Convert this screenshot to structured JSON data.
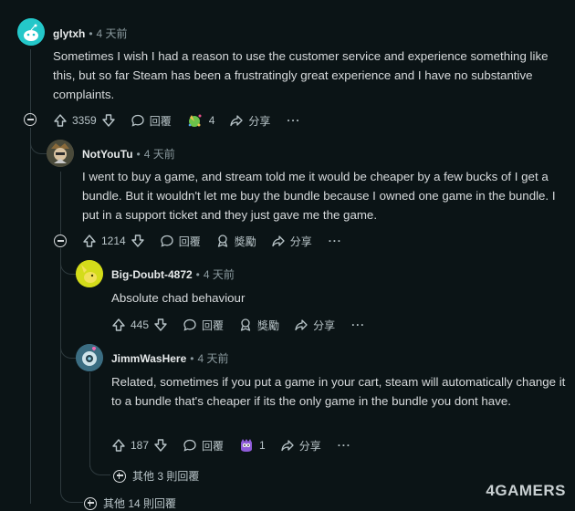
{
  "comments": [
    {
      "username": "glytxh",
      "time": "4 天前",
      "body": "Sometimes I wish I had a reason to use the customer service and experience something like this, but so far Steam has been a frustratingly great experience and I have no substantive complaints.",
      "votes": "3359",
      "reply_label": "回覆",
      "award_count": "4",
      "share_label": "分享",
      "more": "···"
    },
    {
      "username": "NotYouTu",
      "time": "4 天前",
      "body": "I went to buy a game, and stream told me it would be cheaper by a few bucks of I get a bundle. But it wouldn't let me buy the bundle because I owned one game in the bundle. I put in a support ticket and they just gave me the game.",
      "votes": "1214",
      "reply_label": "回覆",
      "award_label": "獎勵",
      "share_label": "分享",
      "more": "···"
    },
    {
      "username": "Big-Doubt-4872",
      "time": "4 天前",
      "body": "Absolute chad behaviour",
      "votes": "445",
      "reply_label": "回覆",
      "award_label": "獎勵",
      "share_label": "分享",
      "more": "···"
    },
    {
      "username": "JimmWasHere",
      "time": "4 天前",
      "body": "Related, sometimes if you put a game in your cart, steam will automatically change it to a bundle that's cheaper if its the only game in the bundle you dont have.",
      "votes": "187",
      "reply_label": "回覆",
      "award_count": "1",
      "share_label": "分享",
      "more": "···"
    }
  ],
  "more_replies_1": "其他 3 則回覆",
  "more_replies_2": "其他 14 則回覆",
  "separator": "•",
  "watermark": "4GAMERS",
  "colors": {
    "background": "#0b1416",
    "text": "#d7dadc",
    "meta": "#8b9a9f",
    "line": "#2e3a3e"
  }
}
